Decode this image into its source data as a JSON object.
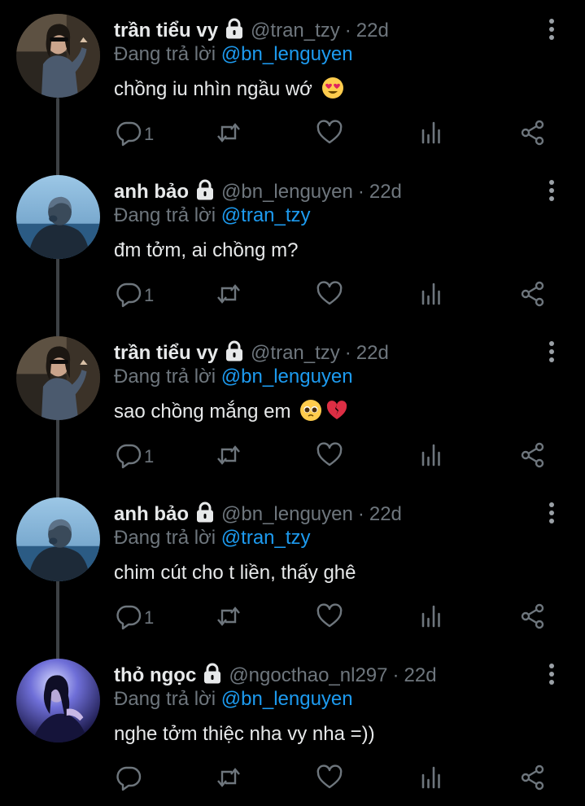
{
  "reply_prefix": "Đang trả lời",
  "icons": {
    "more": "more-vertical-icon",
    "lock": "lock-icon",
    "reply": "comment-icon",
    "retweet": "retweet-icon",
    "like": "heart-icon",
    "analytics": "analytics-icon",
    "share": "share-icon"
  },
  "colors": {
    "background": "#000000",
    "name": "#e7e9ea",
    "muted": "#6e767d",
    "mention": "#1d9bf0",
    "thread_line": "#3d4145"
  },
  "tweets": [
    {
      "name": "trần tiểu vy",
      "handle": "@tran_tzy",
      "time": "22d",
      "reply_to": "@bn_lenguyen",
      "text": "chồng iu nhìn ngầu wớ",
      "emoji": [
        "heart-eyes-emoji"
      ],
      "reply_count": "1"
    },
    {
      "name": "anh bảo",
      "handle": "@bn_lenguyen",
      "time": "22d",
      "reply_to": "@tran_tzy",
      "text": "đm tởm, ai chồng m?",
      "emoji": [],
      "reply_count": "1"
    },
    {
      "name": "trần tiểu vy",
      "handle": "@tran_tzy",
      "time": "22d",
      "reply_to": "@bn_lenguyen",
      "text": "sao chồng mắng em",
      "emoji": [
        "pleading-face-emoji",
        "broken-heart-emoji"
      ],
      "reply_count": "1"
    },
    {
      "name": "anh bảo",
      "handle": "@bn_lenguyen",
      "time": "22d",
      "reply_to": "@tran_tzy",
      "text": "chim cút cho t liền, thấy ghê",
      "emoji": [],
      "reply_count": "1"
    },
    {
      "name": "thỏ ngọc",
      "handle": "@ngocthao_nl297",
      "time": "22d",
      "reply_to": "@bn_lenguyen",
      "text": "nghe tởm thiệc nha vy nha =))",
      "emoji": [],
      "reply_count": ""
    }
  ]
}
